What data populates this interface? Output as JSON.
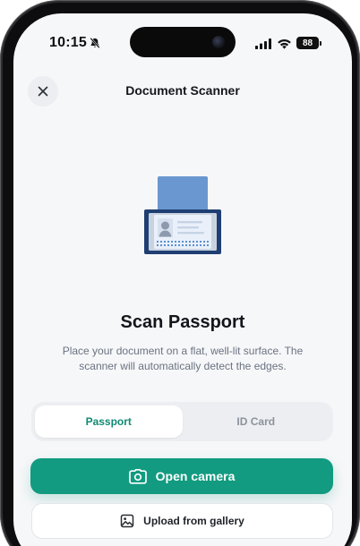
{
  "status_bar": {
    "time": "10:15",
    "battery_level": "88",
    "icons": [
      "bell-slash-icon",
      "cellular-signal-icon",
      "wifi-icon",
      "battery-icon"
    ]
  },
  "header": {
    "title": "Document Scanner",
    "close_icon": "close-icon"
  },
  "illustration": {
    "icon": "passport-scanner-illustration",
    "colors": {
      "frame": "#1f3f72",
      "paper": "#6a97cf",
      "card": "#e7eef9",
      "dots": "#5a8fcf"
    }
  },
  "content": {
    "title": "Scan Passport",
    "description": "Place your document on a flat, well-lit surface. The scanner will automatically detect the edges."
  },
  "document_type": {
    "options": [
      "Passport",
      "ID Card"
    ],
    "selected": "Passport"
  },
  "actions": {
    "open_camera": {
      "label": "Open camera",
      "icon": "camera-icon"
    },
    "upload_gallery": {
      "label": "Upload from gallery",
      "icon": "image-icon"
    }
  },
  "colors": {
    "accent": "#129b80",
    "accent_text": "#0f8a72",
    "background": "#f6f7f9"
  }
}
